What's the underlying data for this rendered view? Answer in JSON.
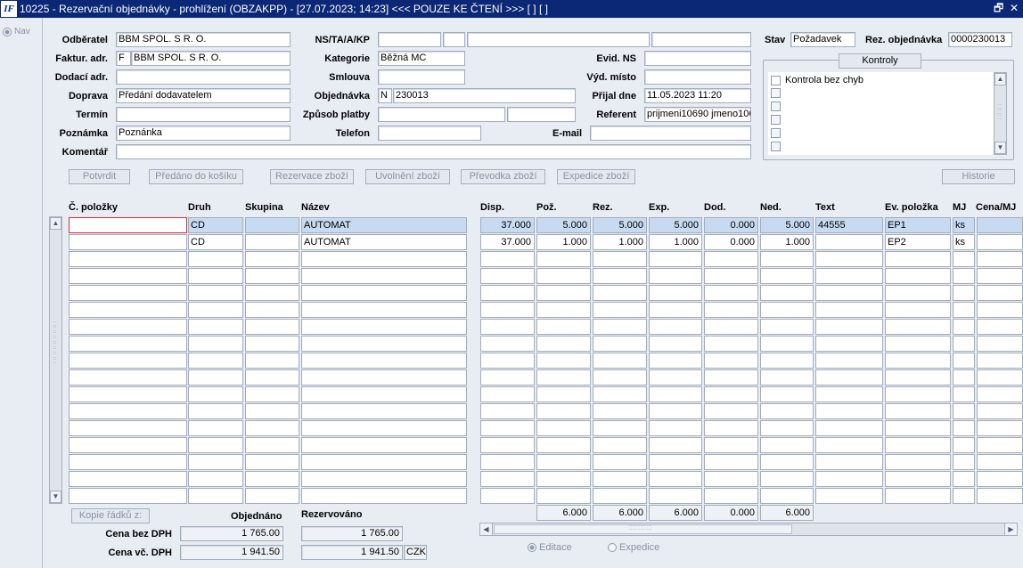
{
  "window": {
    "title": "10225 - Rezervační objednávky -  prohlížení (OBZAKPP) - [27.07.2023; 14:23] <<< POUZE KE ČTENÍ >>>  [ ] [ ]",
    "logo": "IF",
    "restore_glyph": "🗗",
    "close_glyph": "✕"
  },
  "nav": {
    "label": "Nav"
  },
  "header": {
    "odberatel": {
      "label": "Odběratel",
      "value": "BBM SPOL. S R. O."
    },
    "faktur": {
      "label": "Faktur. adr.",
      "code": "F",
      "value": "BBM SPOL. S R. O."
    },
    "dodaci": {
      "label": "Dodací adr.",
      "value": ""
    },
    "doprava": {
      "label": "Doprava",
      "value": "Předání dodavatelem"
    },
    "termin": {
      "label": "Termín",
      "value": ""
    },
    "poznamka": {
      "label": "Poznámka",
      "value": "Poznánka"
    },
    "komentar": {
      "label": "Komentář",
      "value": ""
    },
    "ns": {
      "label": "NS/TA/A/KP"
    },
    "kategorie": {
      "label": "Kategorie",
      "value": "Běžná MC"
    },
    "smlouva": {
      "label": "Smlouva",
      "value": ""
    },
    "objednavka": {
      "label": "Objednávka",
      "code": "N",
      "value": "230013"
    },
    "platby": {
      "label": "Způsob platby",
      "value": ""
    },
    "telefon": {
      "label": "Telefon",
      "value": ""
    },
    "evid": {
      "label": "Evid. NS",
      "value": ""
    },
    "vyd": {
      "label": "Výd. místo",
      "value": ""
    },
    "prijal": {
      "label": "Přijal dne",
      "value": "11.05.2023 11:20"
    },
    "referent": {
      "label": "Referent",
      "value": "prijmeni10690 jmeno106"
    },
    "email": {
      "label": "E-mail",
      "value": ""
    },
    "stav": {
      "label": "Stav",
      "value": "Požadavek"
    },
    "rez": {
      "label": "Rez. objednávka",
      "value": "0000230013"
    }
  },
  "controls": {
    "button": "Kontroly",
    "items": [
      {
        "label": "Kontrola bez chyb"
      },
      {
        "label": ""
      },
      {
        "label": ""
      },
      {
        "label": ""
      },
      {
        "label": ""
      },
      {
        "label": ""
      }
    ]
  },
  "toolbar": {
    "potvrdit": "Potvrdit",
    "predano": "Předáno do košíku",
    "rezervace": "Rezervace zboží",
    "uvolneni": "Uvolnění zboží",
    "prevodka": "Převodka zboží",
    "expedice": "Expedice zboží",
    "historie": "Historie"
  },
  "table": {
    "headers": {
      "polozka": "Č. položky",
      "druh": "Druh",
      "skupina": "Skupina",
      "nazev": "Název",
      "disp": "Disp.",
      "poz": "Pož.",
      "rez": "Rez.",
      "exp": "Exp.",
      "dod": "Dod.",
      "ned": "Ned.",
      "text": "Text",
      "evpol": "Ev. položka",
      "mj": "MJ",
      "cena": "Cena/MJ"
    },
    "rows": [
      {
        "polozka": "",
        "druh": "CD",
        "skupina": "",
        "nazev": "AUTOMAT",
        "disp": "37.000",
        "poz": "5.000",
        "rez": "5.000",
        "exp": "5.000",
        "dod": "0.000",
        "ned": "5.000",
        "text": "44555",
        "evpol": "EP1",
        "mj": "ks",
        "cena": ""
      },
      {
        "polozka": "",
        "druh": "CD",
        "skupina": "",
        "nazev": "AUTOMAT",
        "disp": "37.000",
        "poz": "1.000",
        "rez": "1.000",
        "exp": "1.000",
        "dod": "0.000",
        "ned": "1.000",
        "text": "",
        "evpol": "EP2",
        "mj": "ks",
        "cena": ""
      }
    ],
    "totals": {
      "poz": "6.000",
      "rez": "6.000",
      "exp": "6.000",
      "dod": "0.000",
      "ned": "6.000"
    }
  },
  "footer": {
    "kopie": "Kopie řádků z:",
    "objednano": "Objednáno",
    "rezervovano": "Rezervováno",
    "bez_dph": {
      "label": "Cena bez DPH",
      "objednano": "1 765.00",
      "rezervovano": "1 765.00"
    },
    "vc_dph": {
      "label": "Cena vč. DPH",
      "objednano": "1 941.50",
      "rezervovano": "1 941.50",
      "mena": "CZK"
    },
    "mode": {
      "editace": "Editace",
      "expedice": "Expedice",
      "selected": "editace"
    }
  }
}
